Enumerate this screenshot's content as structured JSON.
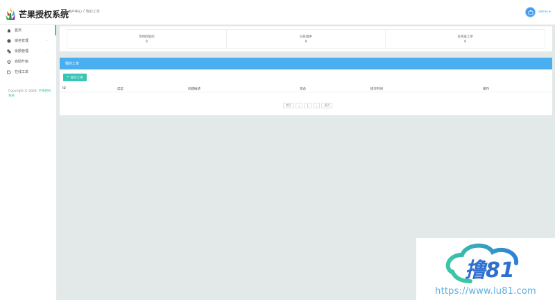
{
  "header": {
    "logo_text": "芒果授权系统",
    "breadcrumb": [
      "用户中心",
      "/",
      "我的工单"
    ],
    "user_name": "admin ▾"
  },
  "sidebar": {
    "items": [
      {
        "label": "首页",
        "icon": "home-icon",
        "has_arrow": false,
        "active": true
      },
      {
        "label": "域名管理",
        "icon": "globe-icon",
        "has_arrow": true,
        "active": false
      },
      {
        "label": "余额管理",
        "icon": "wallet-icon",
        "has_arrow": true,
        "active": false
      },
      {
        "label": "自助升级",
        "icon": "upgrade-icon",
        "has_arrow": false,
        "active": false
      },
      {
        "label": "在线工单",
        "icon": "ticket-icon",
        "has_arrow": false,
        "active": false
      }
    ],
    "copyright": "Copyright © 2024.",
    "copyright_link": "芒果授权系统"
  },
  "stats": [
    {
      "label": "等待回复的",
      "value": "0"
    },
    {
      "label": "已处理中",
      "value": "0"
    },
    {
      "label": "已完成工单",
      "value": "0"
    }
  ],
  "panel": {
    "title": "我的工单",
    "add_button": "提交工单",
    "columns": [
      "ID",
      "类型",
      "问题描述",
      "状态",
      "提交时间",
      "操作"
    ]
  },
  "pagination": [
    "首页",
    "«",
    "1",
    "»",
    "尾页"
  ],
  "watermark": {
    "logo_text": "撸81",
    "url": "https://www.lu81.com"
  },
  "colors": {
    "accent": "#38c5b6",
    "panel_header": "#4aaff0",
    "main_bg": "#e3e9e8"
  }
}
